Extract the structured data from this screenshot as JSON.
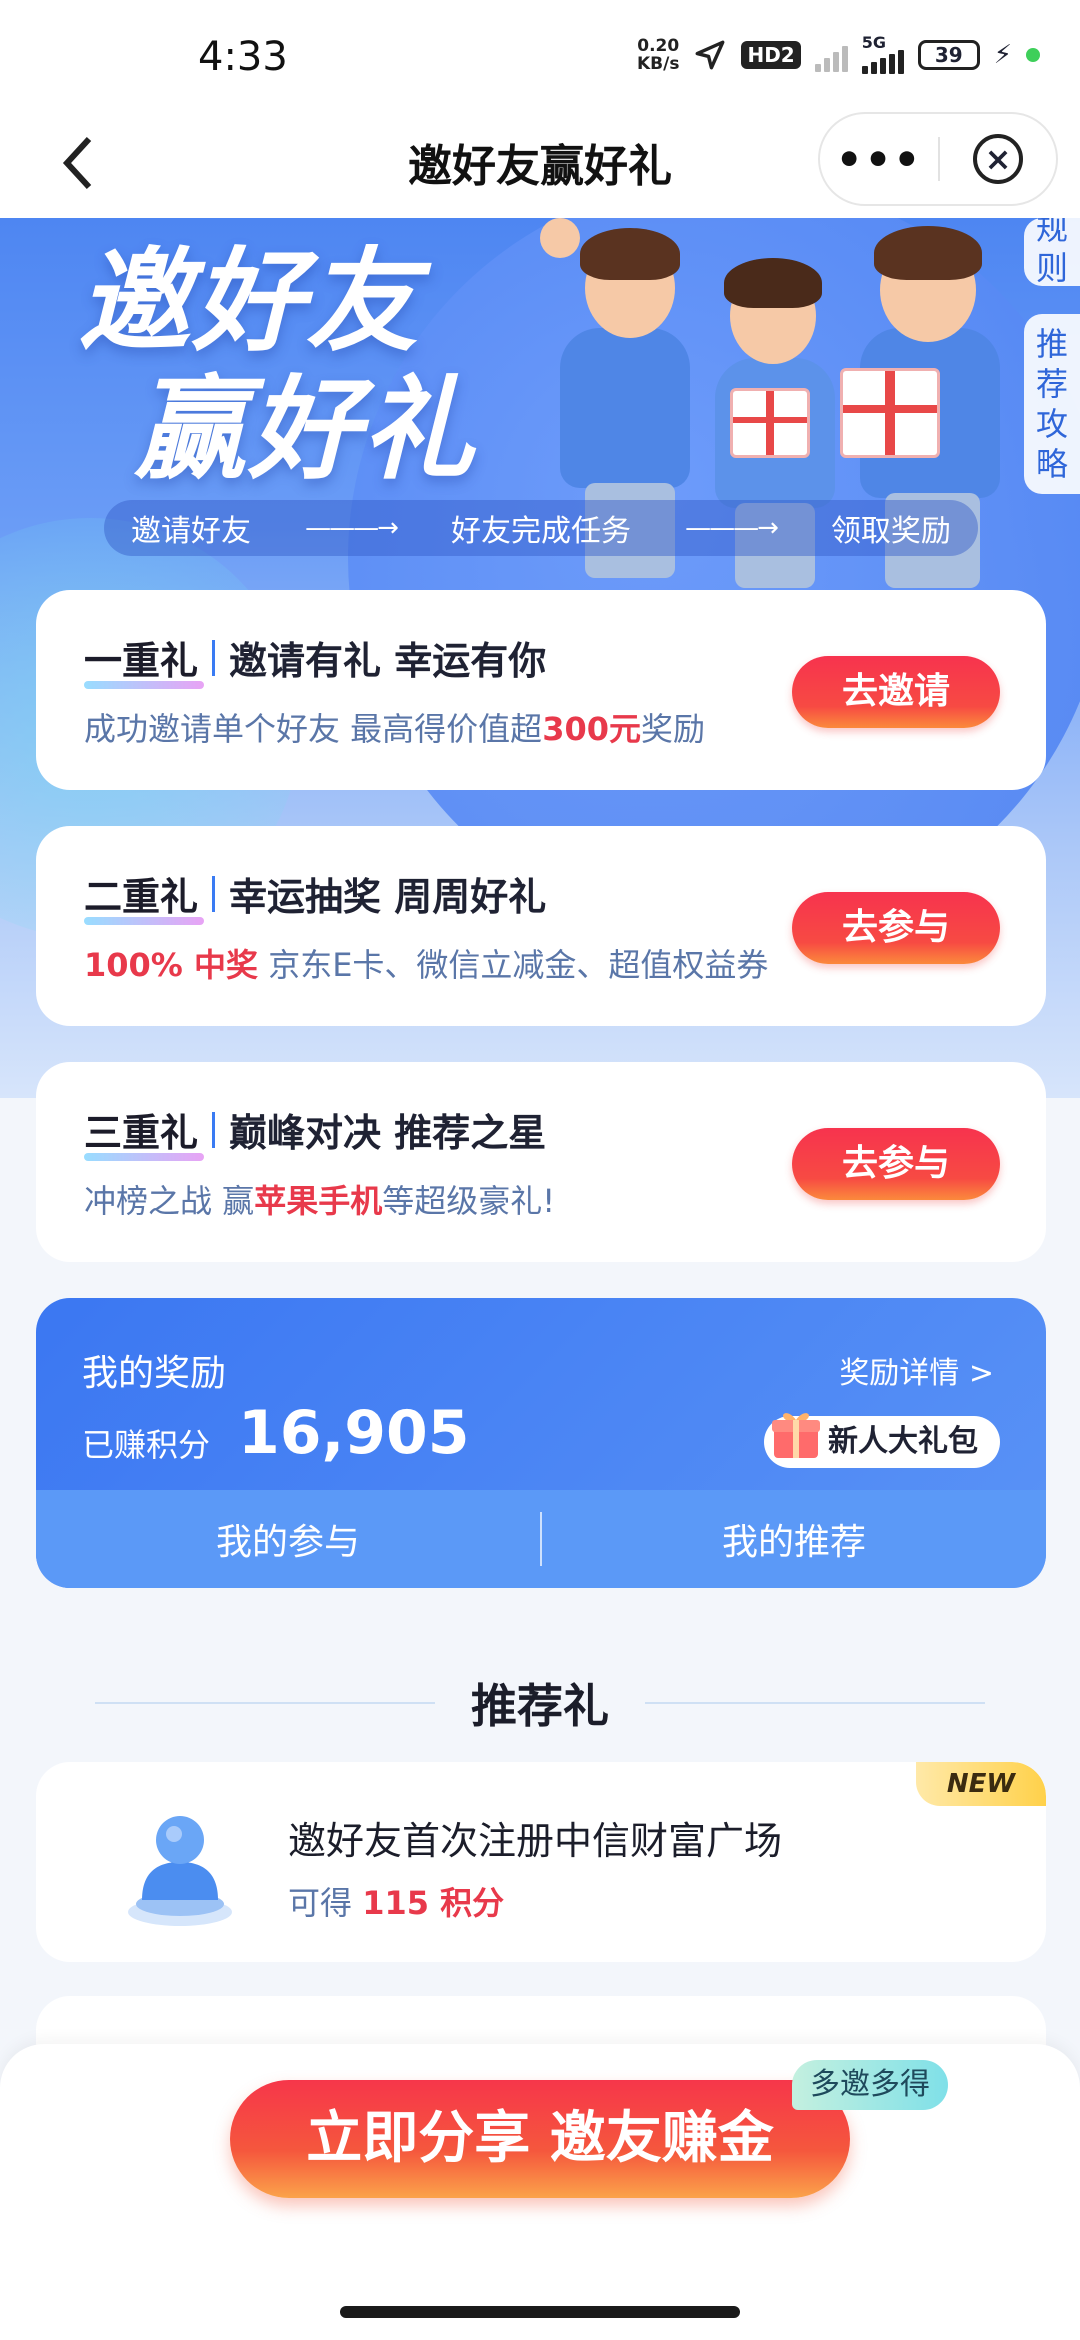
{
  "status_bar": {
    "time": "4:33",
    "net_speed_value": "0.20",
    "net_speed_unit": "KB/s",
    "hd_badge": "HD2",
    "network": "5G",
    "battery": "39"
  },
  "nav": {
    "title": "邀好友赢好礼",
    "more_label": "•••"
  },
  "hero": {
    "title_line1": "邀好友",
    "title_line2": "赢好礼",
    "steps": [
      "邀请好友",
      "好友完成任务",
      "领取奖励"
    ],
    "arrow": "———→",
    "side_tab_rules": "规则",
    "side_tab_guide": "推荐攻略"
  },
  "cards": [
    {
      "tag": "一重礼",
      "title": "邀请有礼 幸运有你",
      "sub_prefix": "成功邀请单个好友 最高得价值超",
      "sub_highlight": "300元",
      "sub_suffix": "奖励",
      "button": "去邀请"
    },
    {
      "tag": "二重礼",
      "title": "幸运抽奖 周周好礼",
      "sub_highlight": "100% 中奖",
      "sub_suffix": " 京东E卡、微信立减金、超值权益券",
      "button": "去参与"
    },
    {
      "tag": "三重礼",
      "title": "巅峰对决 推荐之星",
      "sub_prefix": "冲榜之战  赢",
      "sub_highlight": "苹果手机",
      "sub_suffix": "等超级豪礼!",
      "button": "去参与"
    }
  ],
  "rewards": {
    "title": "我的奖励",
    "detail_link": "奖励详情 >",
    "points_label": "已赚积分",
    "points_value": "16,905",
    "newbie_pack": "新人大礼包",
    "tab_participation": "我的参与",
    "tab_recommend": "我的推荐"
  },
  "recommend": {
    "section_title": "推荐礼",
    "item": {
      "new_tag": "NEW",
      "title": "邀好友首次注册中信财富广场",
      "points_prefix": "可得 ",
      "points_value": "115 积分"
    }
  },
  "share": {
    "button": "立即分享 邀友赚金",
    "badge": "多邀多得"
  },
  "colors": {
    "primary_blue": "#3b77f2",
    "accent_red": "#e8394b",
    "button_red": "#f7334e"
  }
}
